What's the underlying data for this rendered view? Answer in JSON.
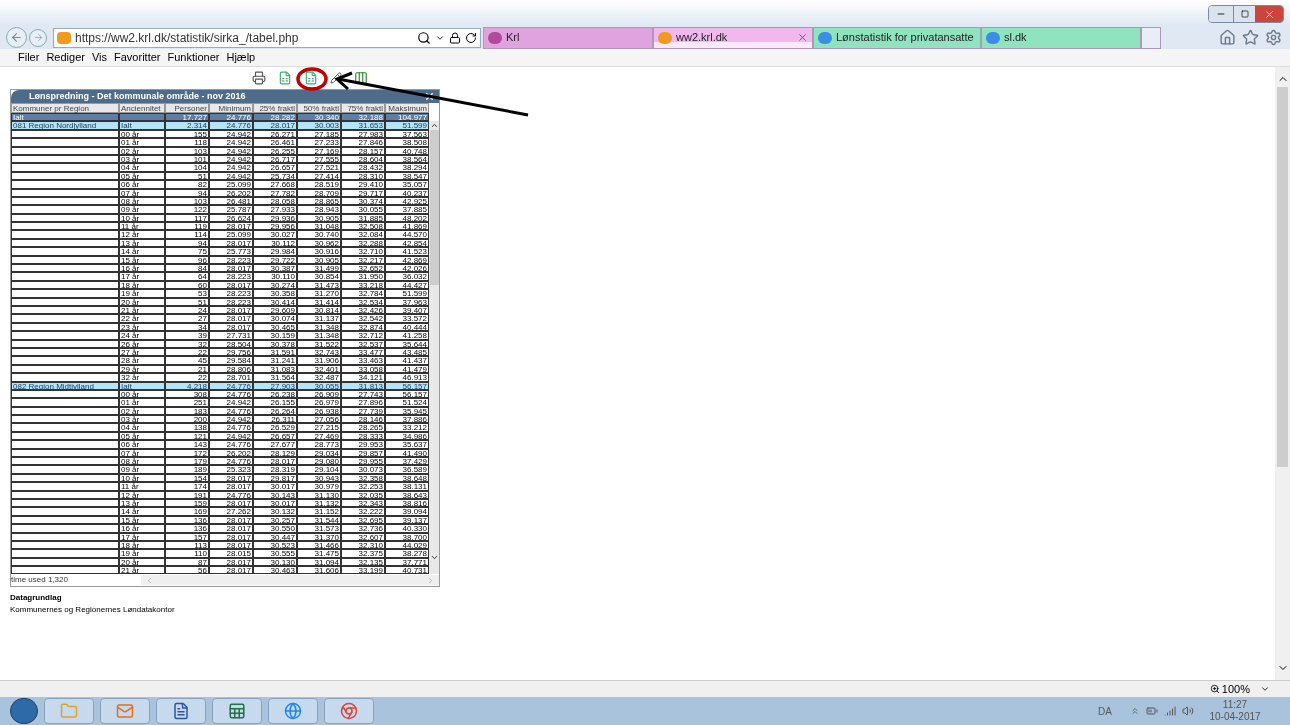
{
  "address": {
    "url": "https://ww2.krl.dk/statistik/sirka_/tabel.php"
  },
  "tabs": [
    {
      "label": "Krl",
      "selected": false,
      "color": "#e0a3e0"
    },
    {
      "label": "ww2.krl.dk",
      "selected": true,
      "color": "#f0b8ec"
    },
    {
      "label": "Lønstatistik for privatansatte",
      "selected": false,
      "color": "#8fe3bf"
    },
    {
      "label": "sl.dk",
      "selected": false,
      "color": "#8fe3bf"
    }
  ],
  "menu": [
    "Filer",
    "Rediger",
    "Vis",
    "Favoritter",
    "Funktioner",
    "Hjælp"
  ],
  "table": {
    "title": "Lønspredning - Det kommunale område - nov 2016",
    "columns": [
      "Kommuner pr Region",
      "Anciennitet",
      "Personer",
      "Minimum",
      "25% fraktl",
      "50% fraktl",
      "75% fraktl",
      "Maksimum"
    ],
    "rows": [
      {
        "kind": "total",
        "region": "Ialt",
        "seniority": "",
        "values": [
          "17.727",
          "24.776",
          "28.282",
          "30.340",
          "32.188",
          "104.977"
        ]
      },
      {
        "kind": "region",
        "region": "081 Region Nordjylland",
        "seniority": "Ialt",
        "values": [
          "2.314",
          "24.776",
          "28.017",
          "30.003",
          "31.653",
          "51.599"
        ]
      },
      {
        "kind": "detail",
        "region": "",
        "seniority": "00 år",
        "values": [
          "155",
          "24.942",
          "26.271",
          "27.185",
          "27.983",
          "37.563"
        ]
      },
      {
        "kind": "detail",
        "region": "",
        "seniority": "01 år",
        "values": [
          "118",
          "24.942",
          "26.461",
          "27.233",
          "27.846",
          "38.508"
        ]
      },
      {
        "kind": "detail",
        "region": "",
        "seniority": "02 år",
        "values": [
          "103",
          "24.942",
          "26.255",
          "27.169",
          "28.157",
          "40.748"
        ]
      },
      {
        "kind": "detail",
        "region": "",
        "seniority": "03 år",
        "values": [
          "101",
          "24.942",
          "26.717",
          "27.555",
          "28.604",
          "38.564"
        ]
      },
      {
        "kind": "detail",
        "region": "",
        "seniority": "04 år",
        "values": [
          "104",
          "24.942",
          "26.657",
          "27.521",
          "28.432",
          "38.294"
        ]
      },
      {
        "kind": "detail",
        "region": "",
        "seniority": "05 år",
        "values": [
          "51",
          "24.942",
          "25.734",
          "27.414",
          "28.310",
          "38.547"
        ]
      },
      {
        "kind": "detail",
        "region": "",
        "seniority": "06 år",
        "values": [
          "82",
          "25.099",
          "27.668",
          "28.519",
          "29.410",
          "35.057"
        ]
      },
      {
        "kind": "detail",
        "region": "",
        "seniority": "07 år",
        "values": [
          "94",
          "26.202",
          "27.782",
          "28.709",
          "29.717",
          "40.237"
        ]
      },
      {
        "kind": "detail",
        "region": "",
        "seniority": "08 år",
        "values": [
          "103",
          "26.481",
          "28.058",
          "28.865",
          "30.374",
          "42.925"
        ]
      },
      {
        "kind": "detail",
        "region": "",
        "seniority": "09 år",
        "values": [
          "122",
          "25.787",
          "27.933",
          "28.943",
          "30.055",
          "37.885"
        ]
      },
      {
        "kind": "detail",
        "region": "",
        "seniority": "10 år",
        "values": [
          "117",
          "26.624",
          "29.936",
          "30.905",
          "31.885",
          "48.202"
        ]
      },
      {
        "kind": "detail",
        "region": "",
        "seniority": "11 år",
        "values": [
          "119",
          "28.017",
          "29.956",
          "31.048",
          "32.508",
          "41.869"
        ]
      },
      {
        "kind": "detail",
        "region": "",
        "seniority": "12 år",
        "values": [
          "114",
          "25.099",
          "30.027",
          "30.740",
          "32.084",
          "44.570"
        ]
      },
      {
        "kind": "detail",
        "region": "",
        "seniority": "13 år",
        "values": [
          "94",
          "28.017",
          "30.112",
          "30.962",
          "32.288",
          "42.854"
        ]
      },
      {
        "kind": "detail",
        "region": "",
        "seniority": "14 år",
        "values": [
          "75",
          "25.773",
          "29.984",
          "30.916",
          "32.710",
          "41.523"
        ]
      },
      {
        "kind": "detail",
        "region": "",
        "seniority": "15 år",
        "values": [
          "96",
          "28.223",
          "29.722",
          "30.905",
          "32.217",
          "42.869"
        ]
      },
      {
        "kind": "detail",
        "region": "",
        "seniority": "16 år",
        "values": [
          "84",
          "28.017",
          "30.387",
          "31.499",
          "32.652",
          "42.026"
        ]
      },
      {
        "kind": "detail",
        "region": "",
        "seniority": "17 år",
        "values": [
          "64",
          "28.223",
          "30.110",
          "30.854",
          "31.950",
          "36.032"
        ]
      },
      {
        "kind": "detail",
        "region": "",
        "seniority": "18 år",
        "values": [
          "60",
          "28.017",
          "30.274",
          "31.473",
          "33.218",
          "44.427"
        ]
      },
      {
        "kind": "detail",
        "region": "",
        "seniority": "19 år",
        "values": [
          "53",
          "28.223",
          "30.358",
          "31.270",
          "32.784",
          "51.599"
        ]
      },
      {
        "kind": "detail",
        "region": "",
        "seniority": "20 år",
        "values": [
          "51",
          "28.223",
          "30.414",
          "31.414",
          "32.534",
          "37.963"
        ]
      },
      {
        "kind": "detail",
        "region": "",
        "seniority": "21 år",
        "values": [
          "24",
          "28.017",
          "29.609",
          "30.814",
          "32.426",
          "39.407"
        ]
      },
      {
        "kind": "detail",
        "region": "",
        "seniority": "22 år",
        "values": [
          "27",
          "28.017",
          "30.074",
          "31.137",
          "32.542",
          "33.572"
        ]
      },
      {
        "kind": "detail",
        "region": "",
        "seniority": "23 år",
        "values": [
          "34",
          "28.017",
          "30.465",
          "31.348",
          "32.874",
          "40.444"
        ]
      },
      {
        "kind": "detail",
        "region": "",
        "seniority": "24 år",
        "values": [
          "39",
          "27.731",
          "30.159",
          "31.348",
          "32.712",
          "41.258"
        ]
      },
      {
        "kind": "detail",
        "region": "",
        "seniority": "26 år",
        "values": [
          "32",
          "28.504",
          "30.378",
          "31.522",
          "32.537",
          "35.644"
        ]
      },
      {
        "kind": "detail",
        "region": "",
        "seniority": "27 år",
        "values": [
          "22",
          "29.756",
          "31.591",
          "32.743",
          "33.477",
          "43.485"
        ]
      },
      {
        "kind": "detail",
        "region": "",
        "seniority": "28 år",
        "values": [
          "45",
          "29.584",
          "31.241",
          "31.906",
          "33.463",
          "41.437"
        ]
      },
      {
        "kind": "detail",
        "region": "",
        "seniority": "29 år",
        "values": [
          "21",
          "28.806",
          "31.083",
          "32.401",
          "33.058",
          "41.479"
        ]
      },
      {
        "kind": "detail",
        "region": "",
        "seniority": "32 år",
        "values": [
          "22",
          "28.701",
          "31.564",
          "32.487",
          "34.121",
          "46.913"
        ]
      },
      {
        "kind": "region",
        "region": "082 Region Midtjylland",
        "seniority": "Ialt",
        "values": [
          "4.218",
          "24.776",
          "27.903",
          "30.055",
          "31.813",
          "56.157"
        ]
      },
      {
        "kind": "detail",
        "region": "",
        "seniority": "00 år",
        "values": [
          "308",
          "24.776",
          "26.238",
          "26.909",
          "27.743",
          "56.157"
        ]
      },
      {
        "kind": "detail",
        "region": "",
        "seniority": "01 år",
        "values": [
          "251",
          "24.942",
          "26.155",
          "26.979",
          "27.896",
          "51.524"
        ]
      },
      {
        "kind": "detail",
        "region": "",
        "seniority": "02 år",
        "values": [
          "183",
          "24.776",
          "26.264",
          "26.938",
          "27.739",
          "35.945"
        ]
      },
      {
        "kind": "detail",
        "region": "",
        "seniority": "03 år",
        "values": [
          "200",
          "24.942",
          "26.311",
          "27.056",
          "28.146",
          "37.886"
        ]
      },
      {
        "kind": "detail",
        "region": "",
        "seniority": "04 år",
        "values": [
          "138",
          "24.776",
          "26.529",
          "27.215",
          "28.265",
          "33.212"
        ]
      },
      {
        "kind": "detail",
        "region": "",
        "seniority": "05 år",
        "values": [
          "121",
          "24.942",
          "26.657",
          "27.469",
          "28.333",
          "34.986"
        ]
      },
      {
        "kind": "detail",
        "region": "",
        "seniority": "06 år",
        "values": [
          "143",
          "24.776",
          "27.677",
          "28.773",
          "29.953",
          "35.637"
        ]
      },
      {
        "kind": "detail",
        "region": "",
        "seniority": "07 år",
        "values": [
          "172",
          "26.202",
          "28.129",
          "29.034",
          "29.857",
          "41.490"
        ]
      },
      {
        "kind": "detail",
        "region": "",
        "seniority": "08 år",
        "values": [
          "179",
          "24.776",
          "28.017",
          "29.080",
          "29.955",
          "37.429"
        ]
      },
      {
        "kind": "detail",
        "region": "",
        "seniority": "09 år",
        "values": [
          "189",
          "25.323",
          "28.319",
          "29.104",
          "30.073",
          "36.589"
        ]
      },
      {
        "kind": "detail",
        "region": "",
        "seniority": "10 år",
        "values": [
          "154",
          "28.017",
          "29.817",
          "30.943",
          "32.358",
          "38.648"
        ]
      },
      {
        "kind": "detail",
        "region": "",
        "seniority": "11 år",
        "values": [
          "174",
          "28.017",
          "30.017",
          "30.979",
          "32.253",
          "38.131"
        ]
      },
      {
        "kind": "detail",
        "region": "",
        "seniority": "12 år",
        "values": [
          "191",
          "24.776",
          "30.143",
          "31.130",
          "32.035",
          "38.643"
        ]
      },
      {
        "kind": "detail",
        "region": "",
        "seniority": "13 år",
        "values": [
          "159",
          "28.017",
          "30.017",
          "31.132",
          "32.343",
          "38.816"
        ]
      },
      {
        "kind": "detail",
        "region": "",
        "seniority": "14 år",
        "values": [
          "169",
          "27.262",
          "30.132",
          "31.152",
          "32.222",
          "39.094"
        ]
      },
      {
        "kind": "detail",
        "region": "",
        "seniority": "15 år",
        "values": [
          "136",
          "28.017",
          "30.257",
          "31.544",
          "32.695",
          "39.137"
        ]
      },
      {
        "kind": "detail",
        "region": "",
        "seniority": "16 år",
        "values": [
          "136",
          "28.017",
          "30.550",
          "31.573",
          "32.736",
          "40.330"
        ]
      },
      {
        "kind": "detail",
        "region": "",
        "seniority": "17 år",
        "values": [
          "157",
          "28.017",
          "30.447",
          "31.370",
          "32.607",
          "38.700"
        ]
      },
      {
        "kind": "detail",
        "region": "",
        "seniority": "18 år",
        "values": [
          "113",
          "28.017",
          "30.523",
          "31.466",
          "32.310",
          "44.029"
        ]
      },
      {
        "kind": "detail",
        "region": "",
        "seniority": "19 år",
        "values": [
          "110",
          "28.015",
          "30.555",
          "31.475",
          "32.375",
          "38.278"
        ]
      },
      {
        "kind": "detail",
        "region": "",
        "seniority": "20 år",
        "values": [
          "87",
          "28.017",
          "30.130",
          "31.094",
          "32.135",
          "37.771"
        ]
      },
      {
        "kind": "detail",
        "region": "",
        "seniority": "21 år",
        "values": [
          "56",
          "28.017",
          "30.463",
          "31.606",
          "33.199",
          "40.731"
        ]
      }
    ],
    "time_used": "time used 1,320"
  },
  "footer": {
    "heading": "Datagrundlag",
    "source": "Kommunernes og Regionernes Løndatakontor"
  },
  "status_bar": {
    "zoom": "100%"
  },
  "taskbar": {
    "language": "DA",
    "time": "11:27",
    "date": "10-04-2017"
  }
}
